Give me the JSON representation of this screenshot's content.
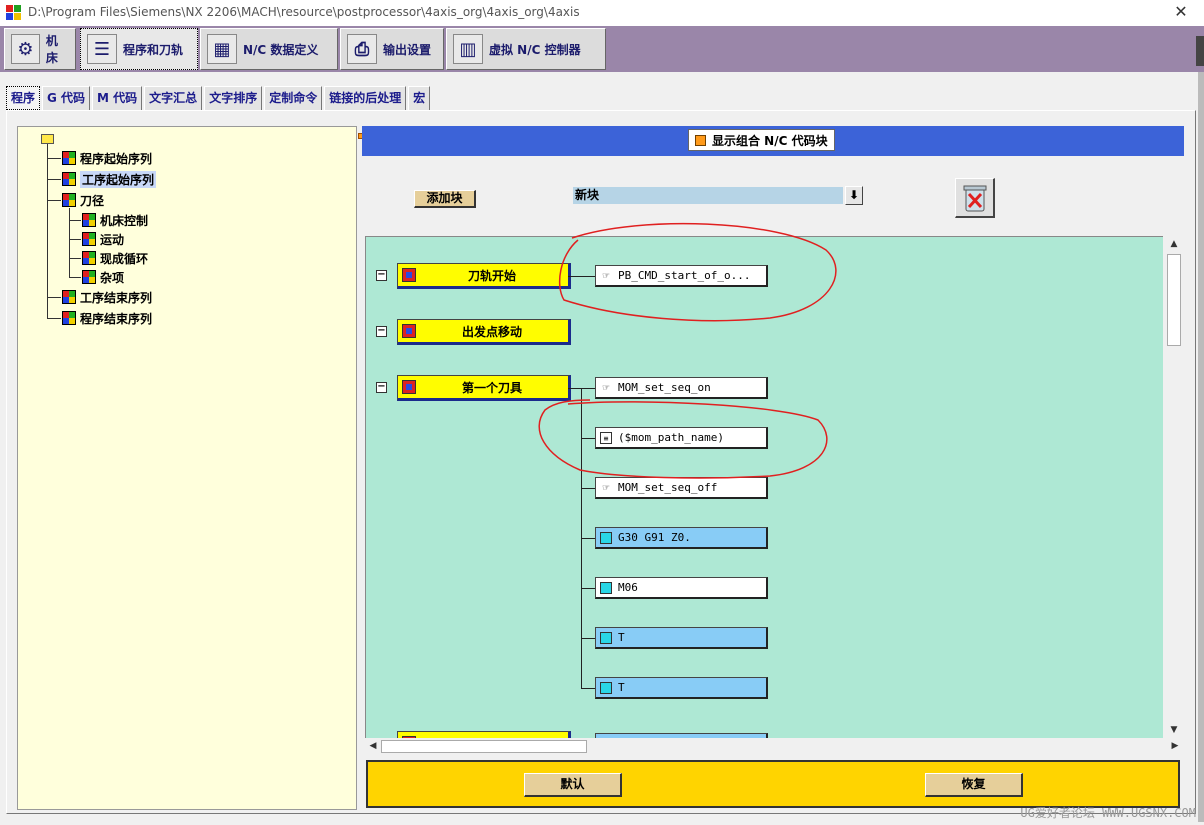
{
  "window": {
    "title": "D:\\Program Files\\Siemens\\NX 2206\\MACH\\resource\\postprocessor\\4axis_org\\4axis_org\\4axis",
    "close_glyph": "✕"
  },
  "top_tabs": [
    {
      "label": "机床",
      "icon": "machine-icon"
    },
    {
      "label": "程序和刀轨",
      "icon": "toolpath-icon"
    },
    {
      "label": "N/C 数据定义",
      "icon": "nc-data-icon"
    },
    {
      "label": "输出设置",
      "icon": "printer-icon"
    },
    {
      "label": "虚拟 N/C 控制器",
      "icon": "controller-icon"
    }
  ],
  "sub_tabs": [
    "程序",
    "G 代码",
    "M 代码",
    "文字汇总",
    "文字排序",
    "定制命令",
    "链接的后处理",
    "宏"
  ],
  "tree": {
    "nodes": [
      {
        "label": "程序起始序列"
      },
      {
        "label": "工序起始序列"
      },
      {
        "label": "刀径"
      },
      {
        "label": "机床控制"
      },
      {
        "label": "运动"
      },
      {
        "label": "现成循环"
      },
      {
        "label": "杂项"
      },
      {
        "label": "工序结束序列"
      },
      {
        "label": "程序结束序列"
      }
    ]
  },
  "header": {
    "label": "显示组合 N/C 代码块"
  },
  "toolbar": {
    "add_block_label": "添加块",
    "new_block_value": "新块",
    "dropdown_glyph": "⬇"
  },
  "events": [
    {
      "label": "刀轨开始"
    },
    {
      "label": "出发点移动"
    },
    {
      "label": "第一个刀具"
    }
  ],
  "blocks": [
    {
      "text": "PB_CMD_start_of_o...",
      "kind": "command",
      "color": "#ffffff"
    },
    {
      "text": "MOM_set_seq_on",
      "kind": "command",
      "color": "#ffffff"
    },
    {
      "text": "($mom_path_name)",
      "kind": "comment",
      "color": "#ffffff"
    },
    {
      "text": "MOM_set_seq_off",
      "kind": "command",
      "color": "#ffffff"
    },
    {
      "text": "G30 G91 Z0.",
      "kind": "block",
      "color": "#88ccf6"
    },
    {
      "text": "M06",
      "kind": "block",
      "color": "#ffffff"
    },
    {
      "text": "T",
      "kind": "block",
      "color": "#88ccf6"
    },
    {
      "text": "T",
      "kind": "block",
      "color": "#88ccf6"
    }
  ],
  "bottom": {
    "default_label": "默认",
    "restore_label": "恢复"
  },
  "watermark": "UG爱好者论坛 WWW.UGSNX.COM",
  "colors": {
    "canvas": "#aee8d4",
    "event_fill": "#fffd00",
    "header_bar": "#3c63d8",
    "bottom_bar": "#ffd400",
    "annotation": "#e02020"
  }
}
